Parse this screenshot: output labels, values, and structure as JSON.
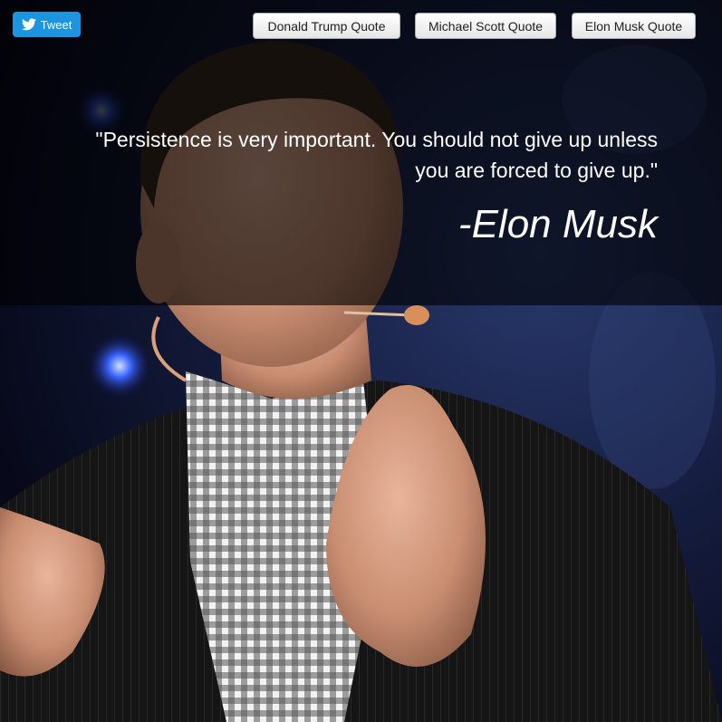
{
  "colors": {
    "tweet_button": "#1b95e0",
    "overlay": "#000000",
    "quote_text": "#ffffff"
  },
  "toolbar": {
    "tweet_label": "Tweet",
    "tweet_icon": "twitter-bird-icon",
    "quote_buttons": [
      {
        "label": "Donald Trump Quote"
      },
      {
        "label": "Michael Scott Quote"
      },
      {
        "label": "Elon Musk Quote"
      }
    ]
  },
  "quote": {
    "text": "\"Persistence is very important. You should not give up unless you are forced to give up.\"",
    "author": "-Elon Musk"
  }
}
